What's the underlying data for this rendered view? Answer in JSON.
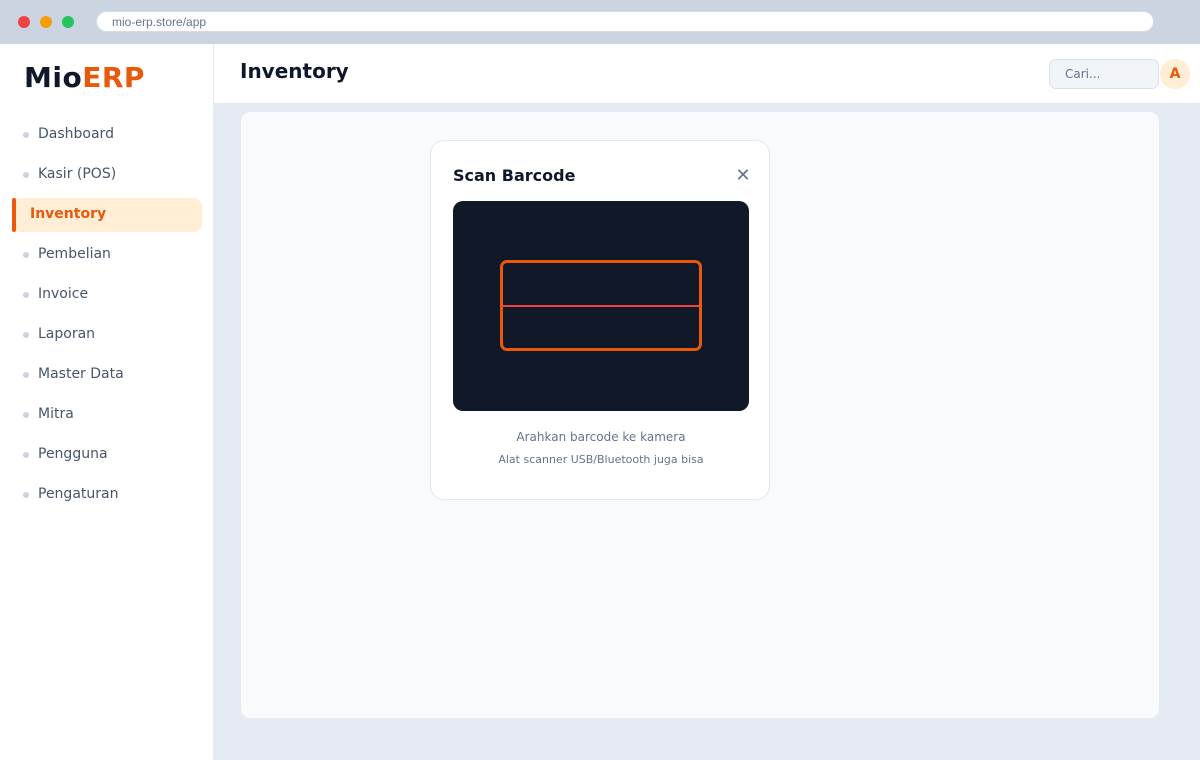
{
  "browser": {
    "url": "mio-erp.store/app"
  },
  "brand": {
    "name_part1": "Mio",
    "name_part2": "ERP",
    "accent_color": "#e8590c"
  },
  "sidebar": {
    "items": [
      {
        "label": "Dashboard",
        "active": false
      },
      {
        "label": "Kasir (POS)",
        "active": false
      },
      {
        "label": "Inventory",
        "active": true
      },
      {
        "label": "Pembelian",
        "active": false
      },
      {
        "label": "Invoice",
        "active": false
      },
      {
        "label": "Laporan",
        "active": false
      },
      {
        "label": "Master Data",
        "active": false
      },
      {
        "label": "Mitra",
        "active": false
      },
      {
        "label": "Pengguna",
        "active": false
      },
      {
        "label": "Pengaturan",
        "active": false
      }
    ]
  },
  "header": {
    "title": "Inventory",
    "search_placeholder": "Cari...",
    "avatar_initial": "A"
  },
  "modal": {
    "title": "Scan Barcode",
    "close_icon": "close-icon",
    "hint_primary": "Arahkan barcode ke kamera",
    "hint_secondary": "Alat scanner USB/Bluetooth juga bisa"
  }
}
